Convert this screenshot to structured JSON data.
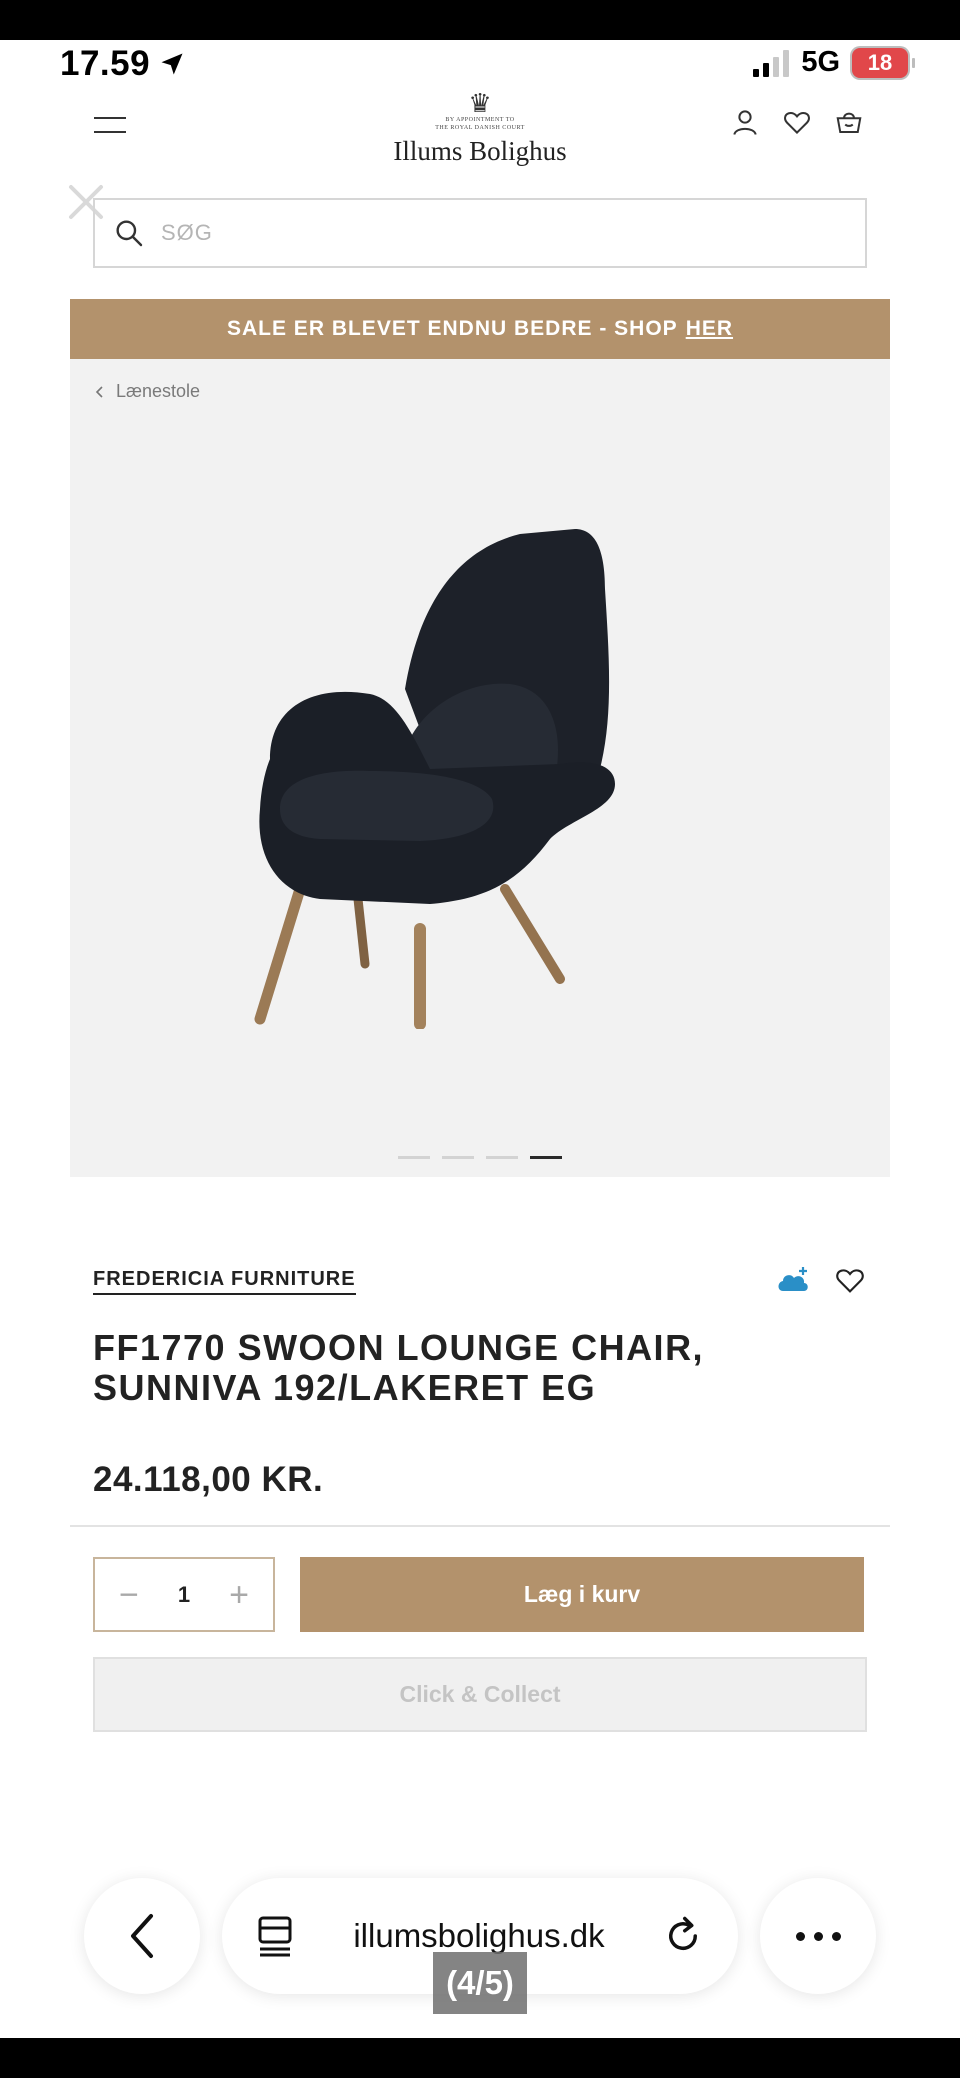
{
  "status_bar": {
    "time": "17.59",
    "network": "5G",
    "battery": "18"
  },
  "header": {
    "logo_appointment_line1": "BY APPOINTMENT TO",
    "logo_appointment_line2": "THE ROYAL DANISH COURT",
    "logo_name": "Illums Bolighus"
  },
  "search": {
    "placeholder": "SØG"
  },
  "promo": {
    "text": "SALE ER BLEVET ENDNU BEDRE - SHOP",
    "link": "HER"
  },
  "breadcrumb": {
    "label": "Lænestole"
  },
  "gallery": {
    "total_images": 4,
    "active_index": 3
  },
  "product": {
    "brand": "FREDERICIA FURNITURE",
    "title": "FF1770 SWOON LOUNGE CHAIR, SUNNIVA 192/LAKERET EG",
    "price": "24.118,00 KR.",
    "quantity": "1",
    "add_to_cart": "Læg i kurv",
    "click_collect": "Click & Collect"
  },
  "browser": {
    "url": "illumsbolighus.dk",
    "page_counter": "(4/5)"
  },
  "colors": {
    "accent": "#b3926c",
    "text": "#222222",
    "background": "#ffffff",
    "media_bg": "#f2f2f2"
  }
}
